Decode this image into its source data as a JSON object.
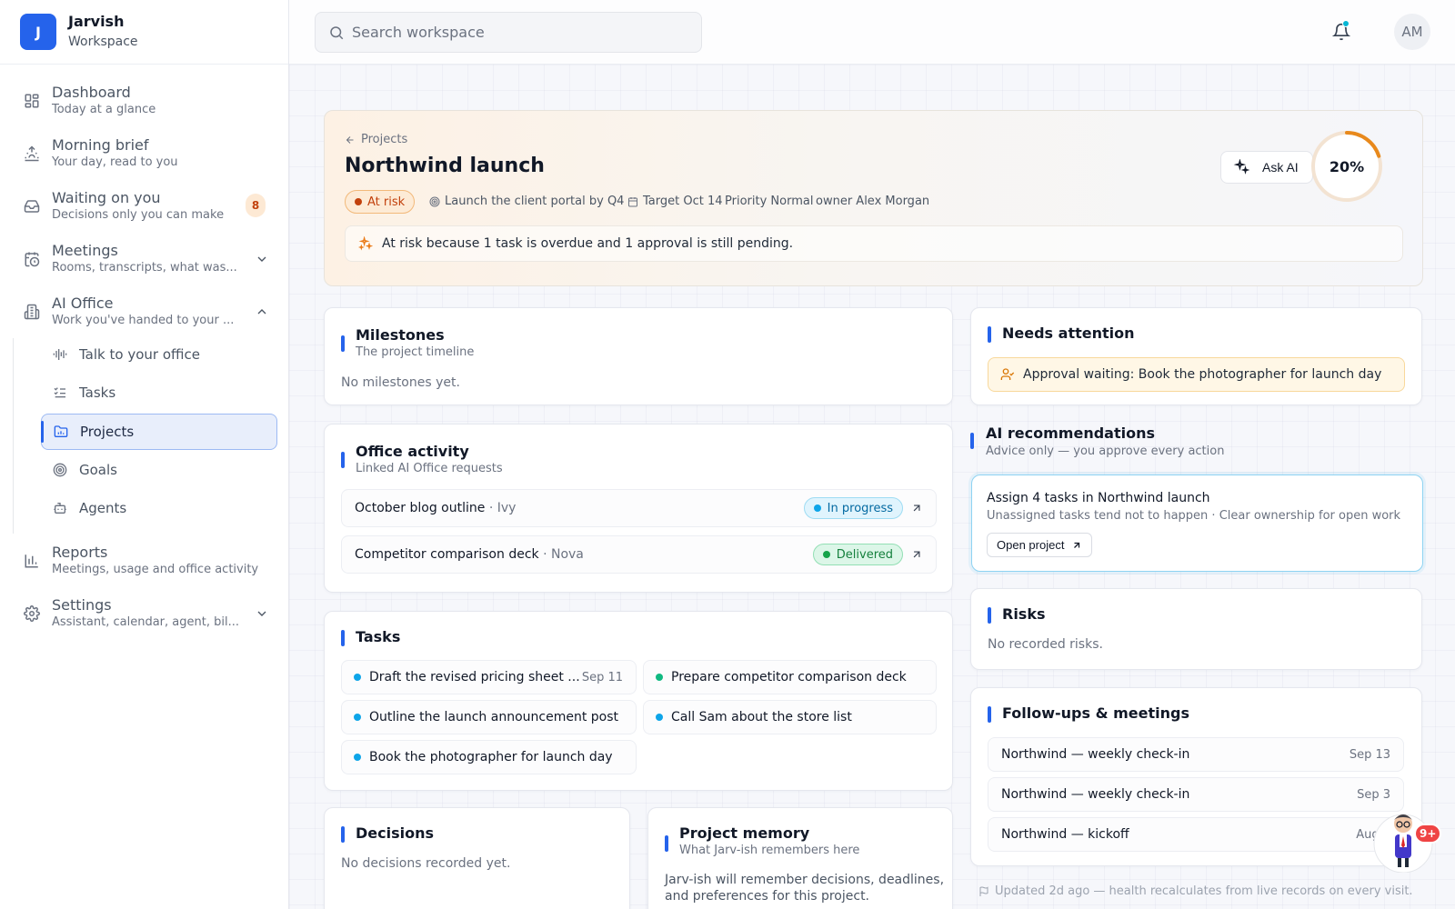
{
  "brand": {
    "logo_letter": "J",
    "name": "Jarvish",
    "subtitle": "Workspace"
  },
  "nav": [
    {
      "title": "Dashboard",
      "desc": "Today at a glance",
      "icon": "dashboard-icon"
    },
    {
      "title": "Morning brief",
      "desc": "Your day, read to you",
      "icon": "sunrise-icon"
    },
    {
      "title": "Waiting on you",
      "desc": "Decisions only you can make",
      "icon": "inbox-icon",
      "badge": "8"
    },
    {
      "title": "Meetings",
      "desc": "Rooms, transcripts, what was...",
      "icon": "calendar-clock-icon",
      "chevron": "down"
    },
    {
      "title": "AI Office",
      "desc": "Work you've handed to your ...",
      "icon": "building-icon",
      "chevron": "up"
    },
    {
      "title": "Reports",
      "desc": "Meetings, usage and office activity",
      "icon": "bar-chart-icon"
    },
    {
      "title": "Settings",
      "desc": "Assistant, calendar, agent, bil...",
      "icon": "gear-icon",
      "chevron": "down"
    }
  ],
  "ai_office_items": [
    {
      "label": "Talk to your office",
      "icon": "waveform-icon"
    },
    {
      "label": "Tasks",
      "icon": "checklist-icon"
    },
    {
      "label": "Projects",
      "icon": "folder-chart-icon",
      "active": true
    },
    {
      "label": "Goals",
      "icon": "target-icon"
    },
    {
      "label": "Agents",
      "icon": "robot-icon"
    }
  ],
  "topbar": {
    "search_placeholder": "Search workspace",
    "avatar_initials": "AM"
  },
  "hero": {
    "breadcrumb": "Projects",
    "title": "Northwind launch",
    "status": "At risk",
    "goal": "Launch the client portal by Q4",
    "target": "Target Oct 14",
    "priority": "Priority Normal",
    "owner": "owner Alex Morgan",
    "note": "At risk because 1 task is overdue and 1 approval is still pending.",
    "ask_ai": "Ask AI",
    "progress_label": "20%",
    "progress_value": 0.2
  },
  "milestones": {
    "title": "Milestones",
    "subtitle": "The project timeline",
    "empty": "No milestones yet."
  },
  "activity": {
    "title": "Office activity",
    "subtitle": "Linked AI Office requests",
    "items": [
      {
        "name": "October blog outline",
        "owner": "· Ivy",
        "status": "In progress"
      },
      {
        "name": "Competitor comparison deck",
        "owner": "· Nova",
        "status": "Delivered"
      }
    ]
  },
  "tasks": {
    "title": "Tasks",
    "items": [
      {
        "label": "Draft the revised pricing sheet ...",
        "date": "Sep 11",
        "dot": "#0ea5e9"
      },
      {
        "label": "Prepare competitor comparison deck",
        "date": "",
        "dot": "#10b981"
      },
      {
        "label": "Outline the launch announcement post",
        "date": "",
        "dot": "#0ea5e9"
      },
      {
        "label": "Call Sam about the store list",
        "date": "",
        "dot": "#0ea5e9"
      },
      {
        "label": "Book the photographer for launch day",
        "date": "",
        "dot": "#0ea5e9"
      }
    ]
  },
  "decisions": {
    "title": "Decisions",
    "empty": "No decisions recorded yet."
  },
  "memory": {
    "title": "Project memory",
    "subtitle": "What Jarv-ish remembers here",
    "body_line1": "Jarv-ish will remember decisions, deadlines,",
    "body_line2": "and preferences for this project."
  },
  "attention": {
    "title": "Needs attention",
    "item": "Approval waiting: Book the photographer for launch day"
  },
  "recommendations": {
    "title": "AI recommendations",
    "subtitle": "Advice only — you approve every action",
    "card_title": "Assign 4 tasks in Northwind launch",
    "card_desc": "Unassigned tasks tend not to happen · Clear ownership for open work",
    "card_button": "Open project"
  },
  "risks": {
    "title": "Risks",
    "empty": "No recorded risks."
  },
  "followups": {
    "title": "Follow-ups & meetings",
    "items": [
      {
        "title": "Northwind — weekly check-in",
        "date": "Sep 13"
      },
      {
        "title": "Northwind — weekly check-in",
        "date": "Sep 3"
      },
      {
        "title": "Northwind — kickoff",
        "date": "Aug 3"
      }
    ]
  },
  "updated_note": "Updated 2d ago — health recalculates from live records on every visit.",
  "mascot_badge": "9+",
  "colors": {
    "accent": "#2563eb",
    "risk": "#c2410c",
    "progress_ring": "#e8891c",
    "in_progress": "#0ea5e9",
    "delivered": "#16a34a"
  }
}
